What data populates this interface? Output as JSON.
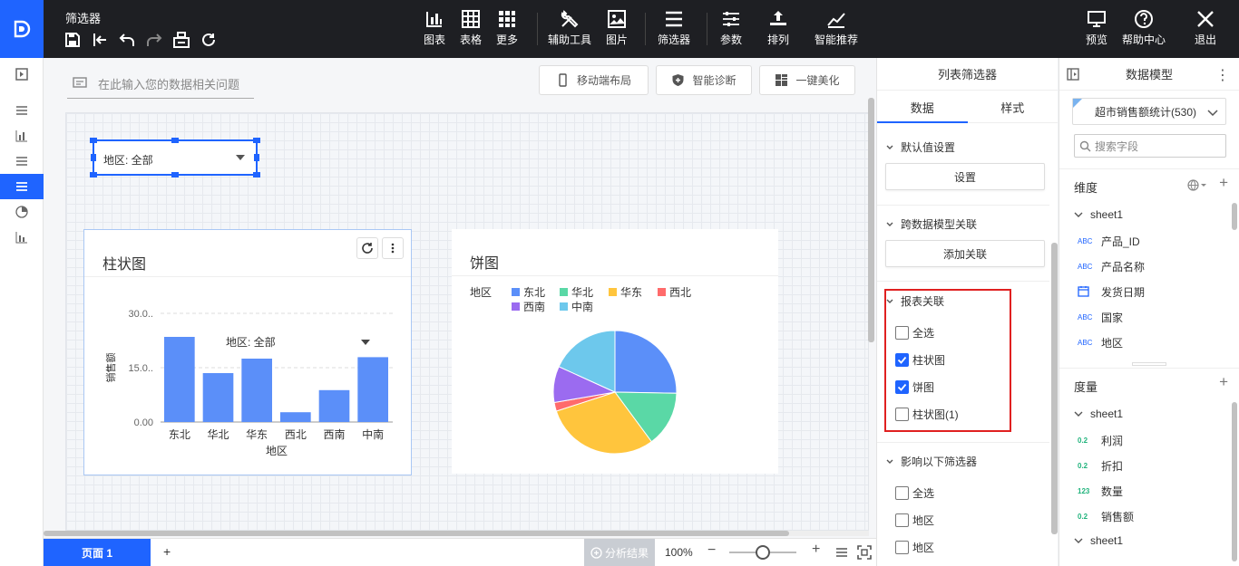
{
  "app": {
    "title": "筛选器"
  },
  "toolbar": {
    "buttons": [
      {
        "label": "图表",
        "icon": "bar-chart-icon"
      },
      {
        "label": "表格",
        "icon": "table-icon"
      },
      {
        "label": "更多",
        "icon": "grid-icon"
      },
      {
        "label": "辅助工具",
        "icon": "tools-icon"
      },
      {
        "label": "图片",
        "icon": "image-icon"
      },
      {
        "label": "筛选器",
        "icon": "filter-list-icon"
      },
      {
        "label": "参数",
        "icon": "sliders-icon"
      },
      {
        "label": "排列",
        "icon": "arrange-icon"
      },
      {
        "label": "智能推荐",
        "icon": "trend-icon"
      }
    ],
    "right_buttons": [
      {
        "label": "预览",
        "icon": "preview-icon"
      },
      {
        "label": "帮助中心",
        "icon": "help-icon"
      },
      {
        "label": "退出",
        "icon": "close-icon"
      }
    ]
  },
  "canvas": {
    "ask_placeholder": "在此输入您的数据相关问题",
    "actions": [
      "移动端布局",
      "智能诊断",
      "一键美化"
    ]
  },
  "filter_widget": {
    "label": "地区: 全部"
  },
  "bar_chart_card": {
    "title": "柱状图",
    "overlay_filter": "地区: 全部"
  },
  "pie_chart_card": {
    "title": "饼图"
  },
  "chart_data": [
    {
      "type": "bar",
      "title": "柱状图",
      "xlabel": "地区",
      "ylabel": "销售额",
      "categories": [
        "东北",
        "华北",
        "华东",
        "西北",
        "西南",
        "中南"
      ],
      "values": [
        23.5,
        13.5,
        17.5,
        2.7,
        8.8,
        17.9
      ],
      "yticks": [
        "0.00",
        "15.0..",
        "30.0.."
      ],
      "ylim": [
        0,
        30
      ],
      "grid": true,
      "color": "#5b8ff9"
    },
    {
      "type": "pie",
      "title": "饼图",
      "legend_title": "地区",
      "legend_position": "top-left",
      "slices": [
        {
          "name": "东北",
          "value": 25.3,
          "color": "#5b8ff9"
        },
        {
          "name": "华北",
          "value": 14.6,
          "color": "#5ad8a6"
        },
        {
          "name": "华东",
          "value": 30.1,
          "color": "#ffc53d"
        },
        {
          "name": "西北",
          "value": 2.3,
          "color": "#ff6b6b"
        },
        {
          "name": "西南",
          "value": 9.5,
          "color": "#9b6bf0"
        },
        {
          "name": "中南",
          "value": 18.2,
          "color": "#6dc8ec"
        }
      ]
    }
  ],
  "filter_panel": {
    "title": "列表筛选器",
    "tabs": [
      "数据",
      "样式"
    ],
    "sections": {
      "default_value": {
        "title": "默认值设置",
        "button": "设置"
      },
      "cross_model": {
        "title": "跨数据模型关联",
        "button": "添加关联"
      },
      "report_link": {
        "title": "报表关联",
        "items": [
          {
            "label": "全选",
            "checked": false
          },
          {
            "label": "柱状图",
            "checked": true
          },
          {
            "label": "饼图",
            "checked": true
          },
          {
            "label": "柱状图(1)",
            "checked": false
          }
        ]
      },
      "affect_filters": {
        "title": "影响以下筛选器",
        "items": [
          {
            "label": "全选",
            "checked": false
          },
          {
            "label": "地区",
            "checked": false
          },
          {
            "label": "地区",
            "checked": false
          }
        ]
      }
    }
  },
  "model_panel": {
    "title": "数据模型",
    "selected_model": "超市销售额统计(530)",
    "search_placeholder": "搜索字段",
    "dimensions": {
      "title": "维度",
      "sheet": "sheet1",
      "fields": [
        {
          "type": "ABC",
          "name": "产品_ID"
        },
        {
          "type": "ABC",
          "name": "产品名称"
        },
        {
          "type": "date",
          "name": "发货日期"
        },
        {
          "type": "ABC",
          "name": "国家"
        },
        {
          "type": "ABC",
          "name": "地区"
        }
      ]
    },
    "measures": {
      "title": "度量",
      "sheet": "sheet1",
      "fields": [
        {
          "type": "0.2",
          "name": "利润"
        },
        {
          "type": "0.2",
          "name": "折扣"
        },
        {
          "type": "123",
          "name": "数量"
        },
        {
          "type": "0.2",
          "name": "销售额"
        }
      ],
      "sheet2": "sheet1"
    }
  },
  "bottom_bar": {
    "page_tab": "页面 1",
    "add_page": "+",
    "analysis": "分析结果",
    "zoom": "100%",
    "zoom_level": 0.5
  }
}
